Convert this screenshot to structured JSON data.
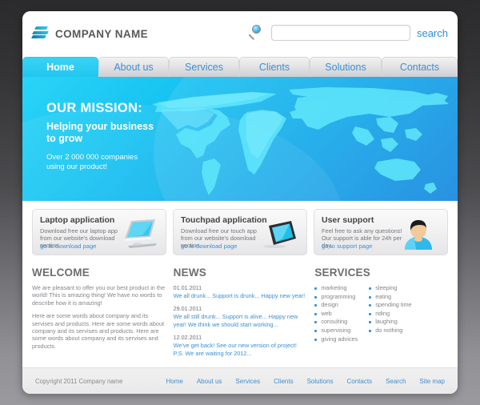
{
  "brand": {
    "name": "COMPANY NAME",
    "logo_icon": "stacked-bars-logo",
    "accent_color": "#22c6f0",
    "link_color": "#3c8fd4"
  },
  "search": {
    "icon": "magnifier-icon",
    "value": "",
    "placeholder": "",
    "button_label": "search"
  },
  "nav": {
    "items": [
      {
        "label": "Home",
        "active": true
      },
      {
        "label": "About us",
        "active": false
      },
      {
        "label": "Services",
        "active": false
      },
      {
        "label": "Clients",
        "active": false
      },
      {
        "label": "Solutions",
        "active": false
      },
      {
        "label": "Contacts",
        "active": false
      }
    ]
  },
  "hero": {
    "title": "OUR MISSION:",
    "subtitle_line1": "Helping your business",
    "subtitle_line2": "to grow",
    "note_line1": "Over 2 000 000 companies",
    "note_line2": "using our product!",
    "background_icon": "world-map"
  },
  "cards": [
    {
      "title": "Laptop application",
      "text": "Download free our laptop app from our website's download section.",
      "link": "go to download page",
      "icon": "laptop-icon"
    },
    {
      "title": "Touchpad application",
      "text": "Download free our touch app from our website's download section.",
      "link": "go to download page",
      "icon": "tablet-icon"
    },
    {
      "title": "User support",
      "text": "Feel free to ask any questions! Our support is able for 24h per day.",
      "link": "go to support page",
      "icon": "user-avatar-icon"
    }
  ],
  "welcome": {
    "heading": "WELCOME",
    "paragraph1": "We are pleasant to offer you our best product in the world! This is amazing thing! We have no words to describe how it is amazing!",
    "paragraph2": "Here are some words about company and its servises and products.  Here are some words about company and its servises and products. Here are some words about company and its servises and products."
  },
  "news": {
    "heading": "NEWS",
    "items": [
      {
        "date": "01.01.2011",
        "text": "We all drunk... Support is drunk... Happy new year!"
      },
      {
        "date": "29.01.2011",
        "text": "We all still drunk... Support is alive... Happy new year! We think we should start working..."
      },
      {
        "date": "12.02.2011",
        "text": "We've get back! See our new version of project! P.S. We are waiting for 2012..."
      }
    ]
  },
  "services": {
    "heading": "SERVICES",
    "column_left": [
      "marketing",
      "programming",
      "design",
      "web",
      "consulting",
      "supervising",
      "giving advices"
    ],
    "column_right": [
      "sleeping",
      "eating",
      "spending time",
      "riding",
      "laughing",
      "do nothing"
    ]
  },
  "footer": {
    "copyright": "Copyright 2011 Company name",
    "links": [
      "Home",
      "About us",
      "Services",
      "Clients",
      "Solutions",
      "Contacts",
      "Search",
      "Site map"
    ]
  }
}
